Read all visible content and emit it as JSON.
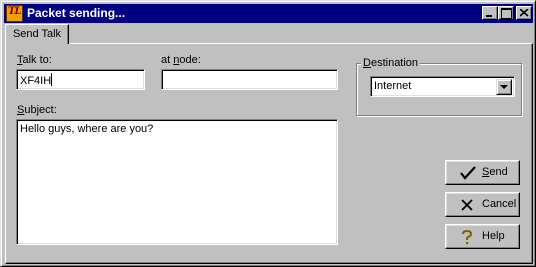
{
  "window": {
    "title": "Packet sending...",
    "app_icon_text": "TL",
    "minimize_label": "",
    "maximize_label": "",
    "close_label": ""
  },
  "tabs": [
    {
      "label": "Send Talk",
      "active": true
    }
  ],
  "form": {
    "talk_to": {
      "label_pre": "",
      "label_accel": "T",
      "label_post": "alk to:",
      "value": "XF4IH"
    },
    "at_node": {
      "label_pre": "at ",
      "label_accel": "n",
      "label_post": "ode:",
      "value": ""
    },
    "subject": {
      "label_pre": "",
      "label_accel": "S",
      "label_post": "ubject:",
      "value": "Hello guys, where are you?"
    },
    "destination": {
      "label_pre": "",
      "label_accel": "D",
      "label_post": "estination",
      "selected": "Internet"
    }
  },
  "buttons": {
    "send": {
      "accel": "S",
      "rest": "end",
      "icon": "checkmark-icon"
    },
    "cancel": {
      "accel": "",
      "rest": "Cancel",
      "icon": "x-icon"
    },
    "help": {
      "accel": "",
      "rest": "Help",
      "icon": "question-icon"
    }
  },
  "colors": {
    "titlebar": "#000080",
    "face": "#c0c0c0",
    "window_text": "#ffffff"
  }
}
